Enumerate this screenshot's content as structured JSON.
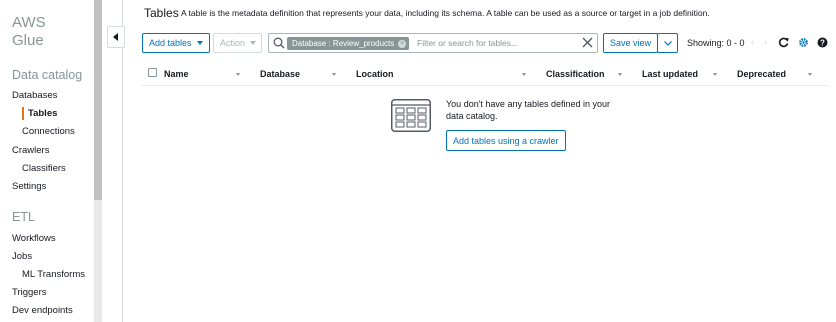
{
  "sidebar": {
    "brand_line1": "AWS",
    "brand_line2": "Glue",
    "data_catalog_heading": "Data catalog",
    "items": {
      "databases": "Databases",
      "tables": "Tables",
      "connections": "Connections",
      "crawlers": "Crawlers",
      "classifiers": "Classifiers",
      "settings": "Settings"
    },
    "etl_heading": "ETL",
    "etl_items": {
      "workflows": "Workflows",
      "jobs": "Jobs",
      "ml_transforms": "ML Transforms",
      "triggers": "Triggers",
      "dev_endpoints": "Dev endpoints"
    },
    "accent_color": "#ec7211"
  },
  "header": {
    "title": "Tables",
    "description": "A table is the metadata definition that represents your data, including its schema. A table can be used as a source or target in a job definition."
  },
  "toolbar": {
    "add_tables_label": "Add tables",
    "action_label": "Action",
    "search_token": "Database : Review_products",
    "search_placeholder": "Filter or search for tables...",
    "save_view_label": "Save view",
    "showing_text": "Showing: 0 - 0"
  },
  "table": {
    "columns": [
      "Name",
      "Database",
      "Location",
      "Classification",
      "Last updated",
      "Deprecated"
    ],
    "rows": []
  },
  "empty_state": {
    "message": "You don't have any tables defined in your data catalog.",
    "button_label": "Add tables using a crawler"
  },
  "icons": [
    "collapse-left-icon",
    "search-icon",
    "clear-icon",
    "refresh-icon",
    "gear-icon",
    "help-icon",
    "table-grid-icon"
  ],
  "colors": {
    "link_blue": "#0073bb",
    "muted": "#879596",
    "gear_blue": "#0073bb"
  }
}
